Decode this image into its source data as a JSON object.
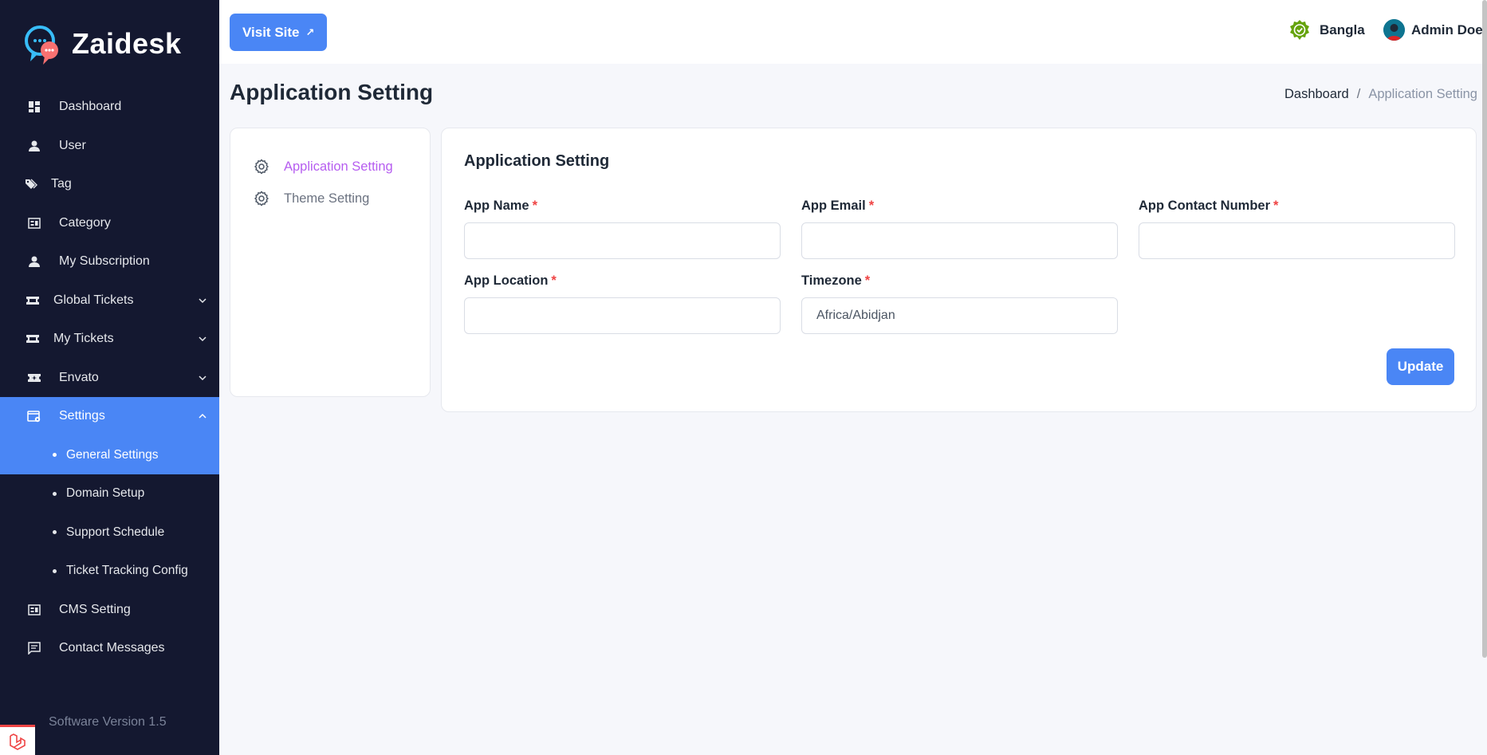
{
  "brand": {
    "name": "Zaidesk"
  },
  "sidebar": {
    "items": [
      {
        "label": "Dashboard",
        "icon": "dashboard-icon"
      },
      {
        "label": "User",
        "icon": "user-icon"
      },
      {
        "label": "Tag",
        "icon": "tag-icon"
      },
      {
        "label": "Category",
        "icon": "category-icon"
      },
      {
        "label": "My Subscription",
        "icon": "user-icon"
      },
      {
        "label": "Global Tickets",
        "icon": "ticket-icon",
        "expandable": true
      },
      {
        "label": "My Tickets",
        "icon": "ticket-icon",
        "expandable": true
      },
      {
        "label": "Envato",
        "icon": "envato-icon",
        "expandable": true
      },
      {
        "label": "Settings",
        "icon": "settings-window-icon",
        "expandable": true,
        "expanded": true,
        "active": true
      }
    ],
    "settings_sub": [
      {
        "label": "General Settings",
        "active": true
      },
      {
        "label": "Domain Setup"
      },
      {
        "label": "Support Schedule"
      },
      {
        "label": "Ticket Tracking Config"
      }
    ],
    "bottom_items": [
      {
        "label": "CMS Setting",
        "icon": "cms-icon"
      },
      {
        "label": "Contact Messages",
        "icon": "message-icon"
      }
    ],
    "version": "Software Version 1.5"
  },
  "topbar": {
    "visit_site": "Visit Site",
    "language": "Bangla",
    "user_name": "Admin Doe"
  },
  "page": {
    "title": "Application Setting",
    "breadcrumb": {
      "home": "Dashboard",
      "separator": "/",
      "current": "Application Setting"
    }
  },
  "settings_menu": [
    {
      "label": "Application Setting",
      "active": true
    },
    {
      "label": "Theme Setting"
    }
  ],
  "form": {
    "title": "Application Setting",
    "required_mark": "*",
    "fields": {
      "app_name": {
        "label": "App Name",
        "value": ""
      },
      "app_email": {
        "label": "App Email",
        "value": ""
      },
      "app_contact": {
        "label": "App Contact Number",
        "value": ""
      },
      "app_location": {
        "label": "App Location",
        "value": ""
      },
      "timezone": {
        "label": "Timezone",
        "value": "Africa/Abidjan"
      }
    },
    "update_button": "Update"
  },
  "colors": {
    "sidebar_bg": "#141830",
    "accent": "#4a86f5",
    "active_link": "#b65df0",
    "required": "#ef4444"
  }
}
